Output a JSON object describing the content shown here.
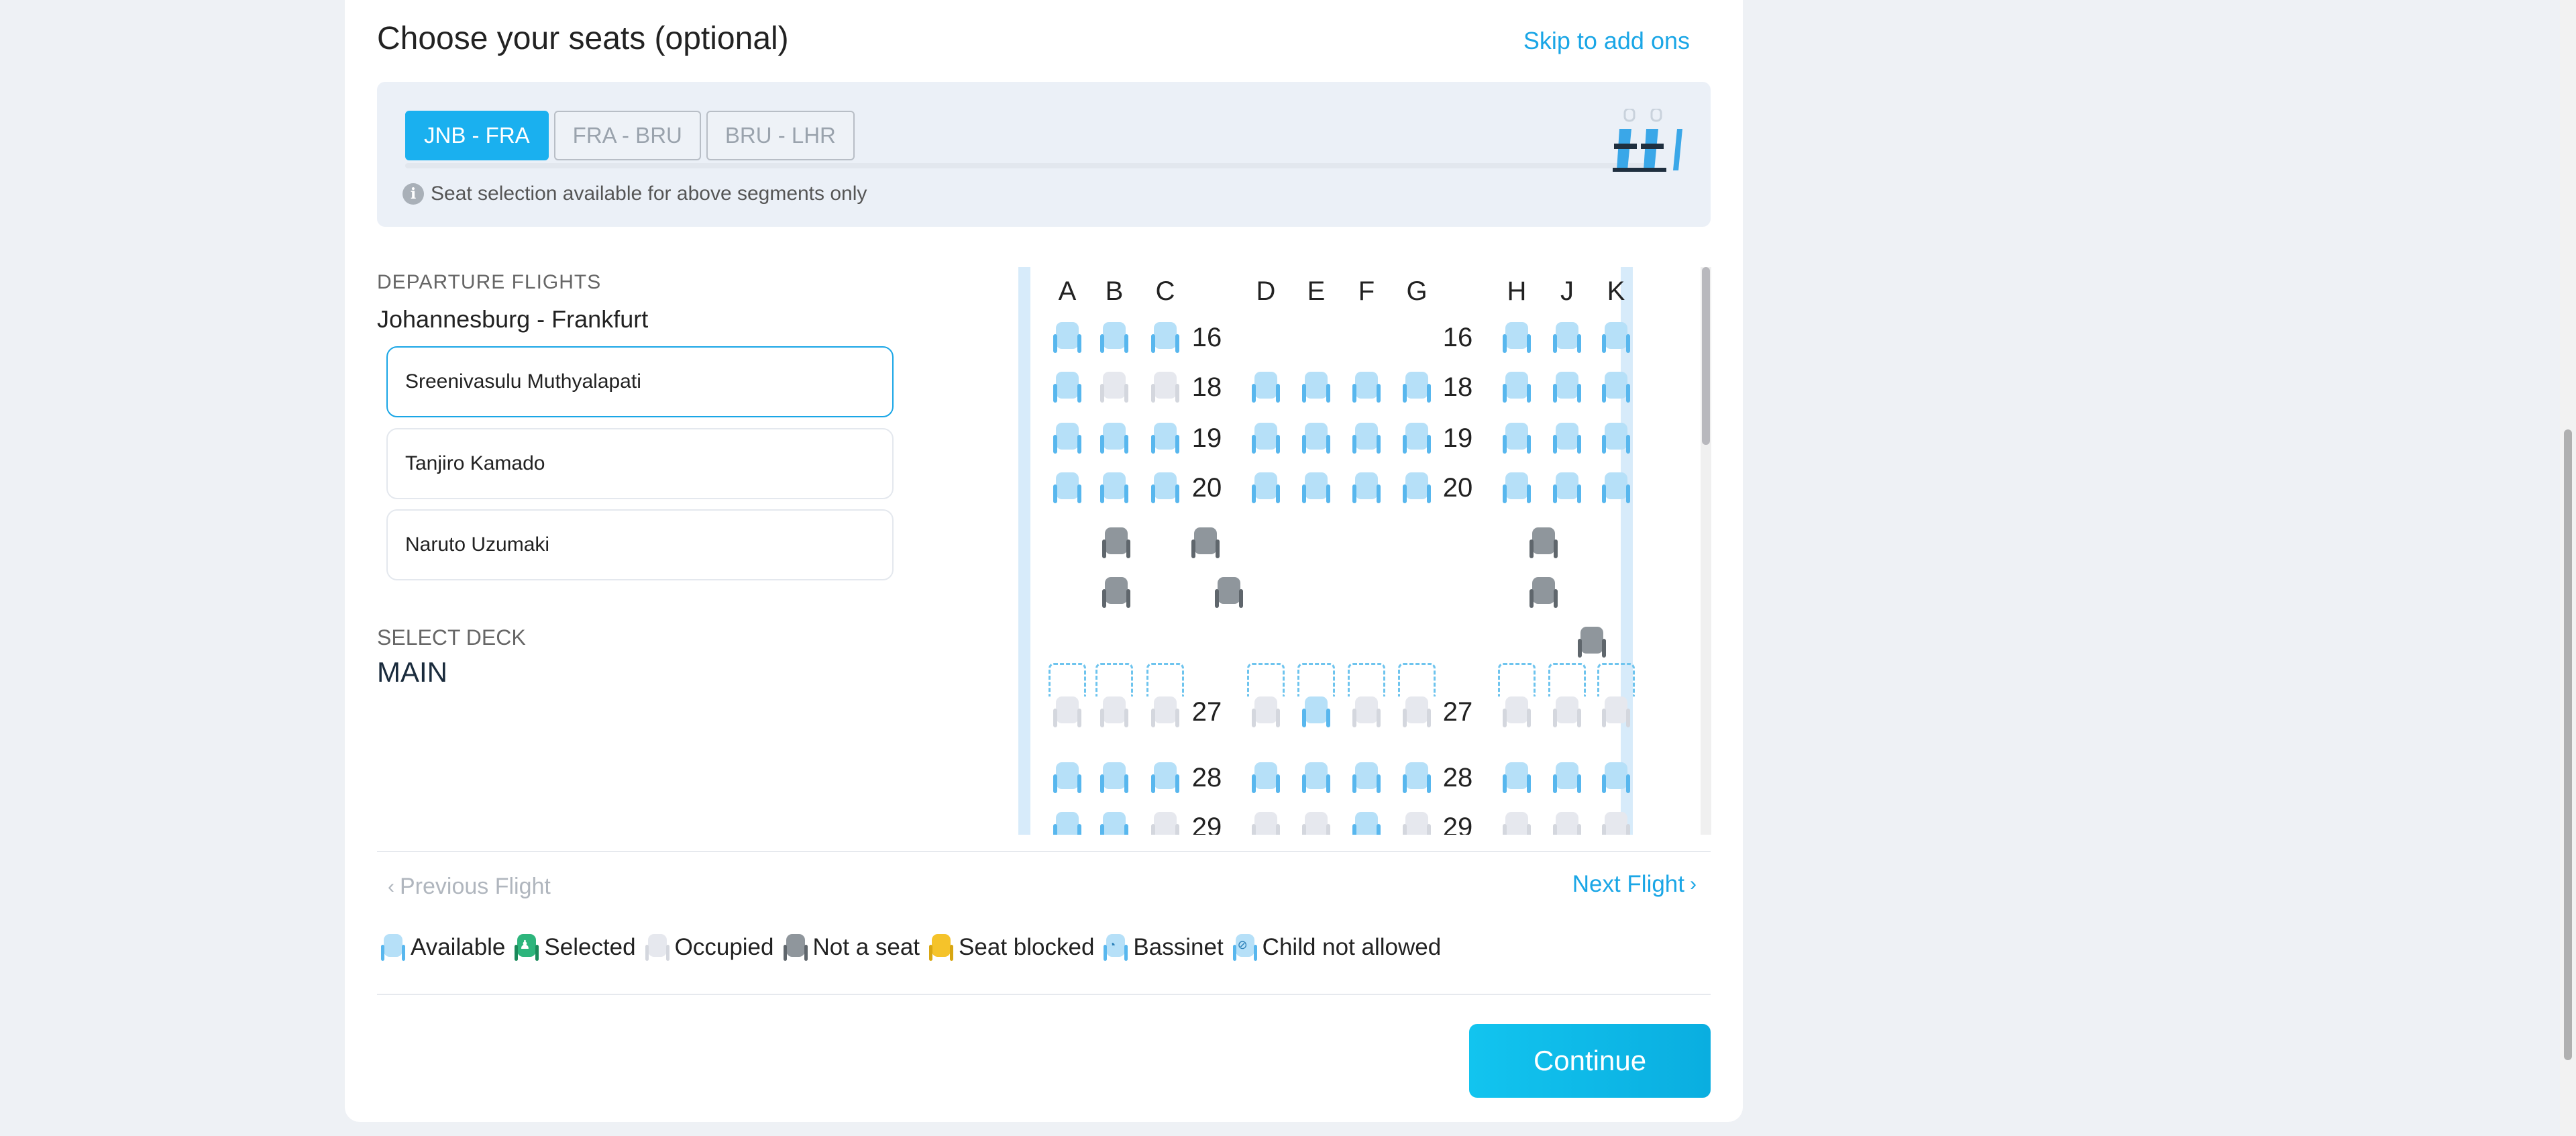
{
  "header": {
    "title": "Choose your seats (optional)",
    "skip_link": "Skip to add ons"
  },
  "segments": {
    "tabs": [
      {
        "label": "JNB - FRA",
        "active": true
      },
      {
        "label": "FRA - BRU",
        "active": false
      },
      {
        "label": "BRU - LHR",
        "active": false
      }
    ],
    "note": "Seat selection available for above segments only",
    "info_icon": "i"
  },
  "flight": {
    "section_label": "DEPARTURE FLIGHTS",
    "route": "Johannesburg - Frankfurt"
  },
  "passengers": [
    {
      "name": "Sreenivasulu Muthyalapati",
      "active": true
    },
    {
      "name": "Tanjiro Kamado",
      "active": false
    },
    {
      "name": "Naruto Uzumaki",
      "active": false
    }
  ],
  "deck": {
    "label": "SELECT DECK",
    "value": "MAIN"
  },
  "seatmap": {
    "columns": [
      "A",
      "B",
      "C",
      "D",
      "E",
      "F",
      "G",
      "H",
      "J",
      "K"
    ],
    "rows": [
      {
        "row": "16",
        "seats": [
          "avail",
          "avail",
          "avail",
          null,
          null,
          null,
          null,
          "avail",
          "avail",
          "avail"
        ]
      },
      {
        "row": "18",
        "seats": [
          "avail",
          "occ",
          "occ",
          "avail",
          "avail",
          "avail",
          "avail",
          "avail",
          "avail",
          "avail"
        ]
      },
      {
        "row": "19",
        "seats": [
          "avail",
          "avail",
          "avail",
          "avail",
          "avail",
          "avail",
          "avail",
          "avail",
          "avail",
          "avail"
        ]
      },
      {
        "row": "20",
        "seats": [
          "avail",
          "avail",
          "avail",
          "avail",
          "avail",
          "avail",
          "avail",
          "avail",
          "avail",
          "avail"
        ]
      },
      {
        "row": "27",
        "bassinet": true,
        "seats": [
          "occ",
          "occ",
          "occ",
          "occ",
          "avail",
          "occ",
          "occ",
          "occ",
          "occ",
          "occ"
        ]
      },
      {
        "row": "28",
        "seats": [
          "avail",
          "avail",
          "avail",
          "avail",
          "avail",
          "avail",
          "avail",
          "avail",
          "avail",
          "avail"
        ]
      },
      {
        "row": "29",
        "seats": [
          "avail",
          "avail",
          "occ",
          "occ",
          "occ",
          "avail",
          "occ",
          "occ",
          "occ",
          "occ"
        ]
      }
    ],
    "facility_markers": 6
  },
  "navigation": {
    "previous": "Previous Flight",
    "next": "Next Flight",
    "prev_chevron": "‹",
    "next_chevron": "›"
  },
  "legend": [
    {
      "label": "Available",
      "type": "avail"
    },
    {
      "label": "Selected",
      "type": "sel",
      "glyph": "♟"
    },
    {
      "label": "Occupied",
      "type": "occ"
    },
    {
      "label": "Not a seat",
      "type": "nas"
    },
    {
      "label": "Seat blocked",
      "type": "blk"
    },
    {
      "label": "Bassinet",
      "type": "avail",
      "glyph": "◔"
    },
    {
      "label": "Child not allowed",
      "type": "avail",
      "glyph": "⊘"
    }
  ],
  "continue_button": "Continue",
  "colors": {
    "accent": "#1aa6e6",
    "available": "#b6e0f8",
    "occupied": "#e6e8ee",
    "not_a_seat": "#8f969c",
    "selected": "#2db57c",
    "blocked": "#f5c32a"
  }
}
